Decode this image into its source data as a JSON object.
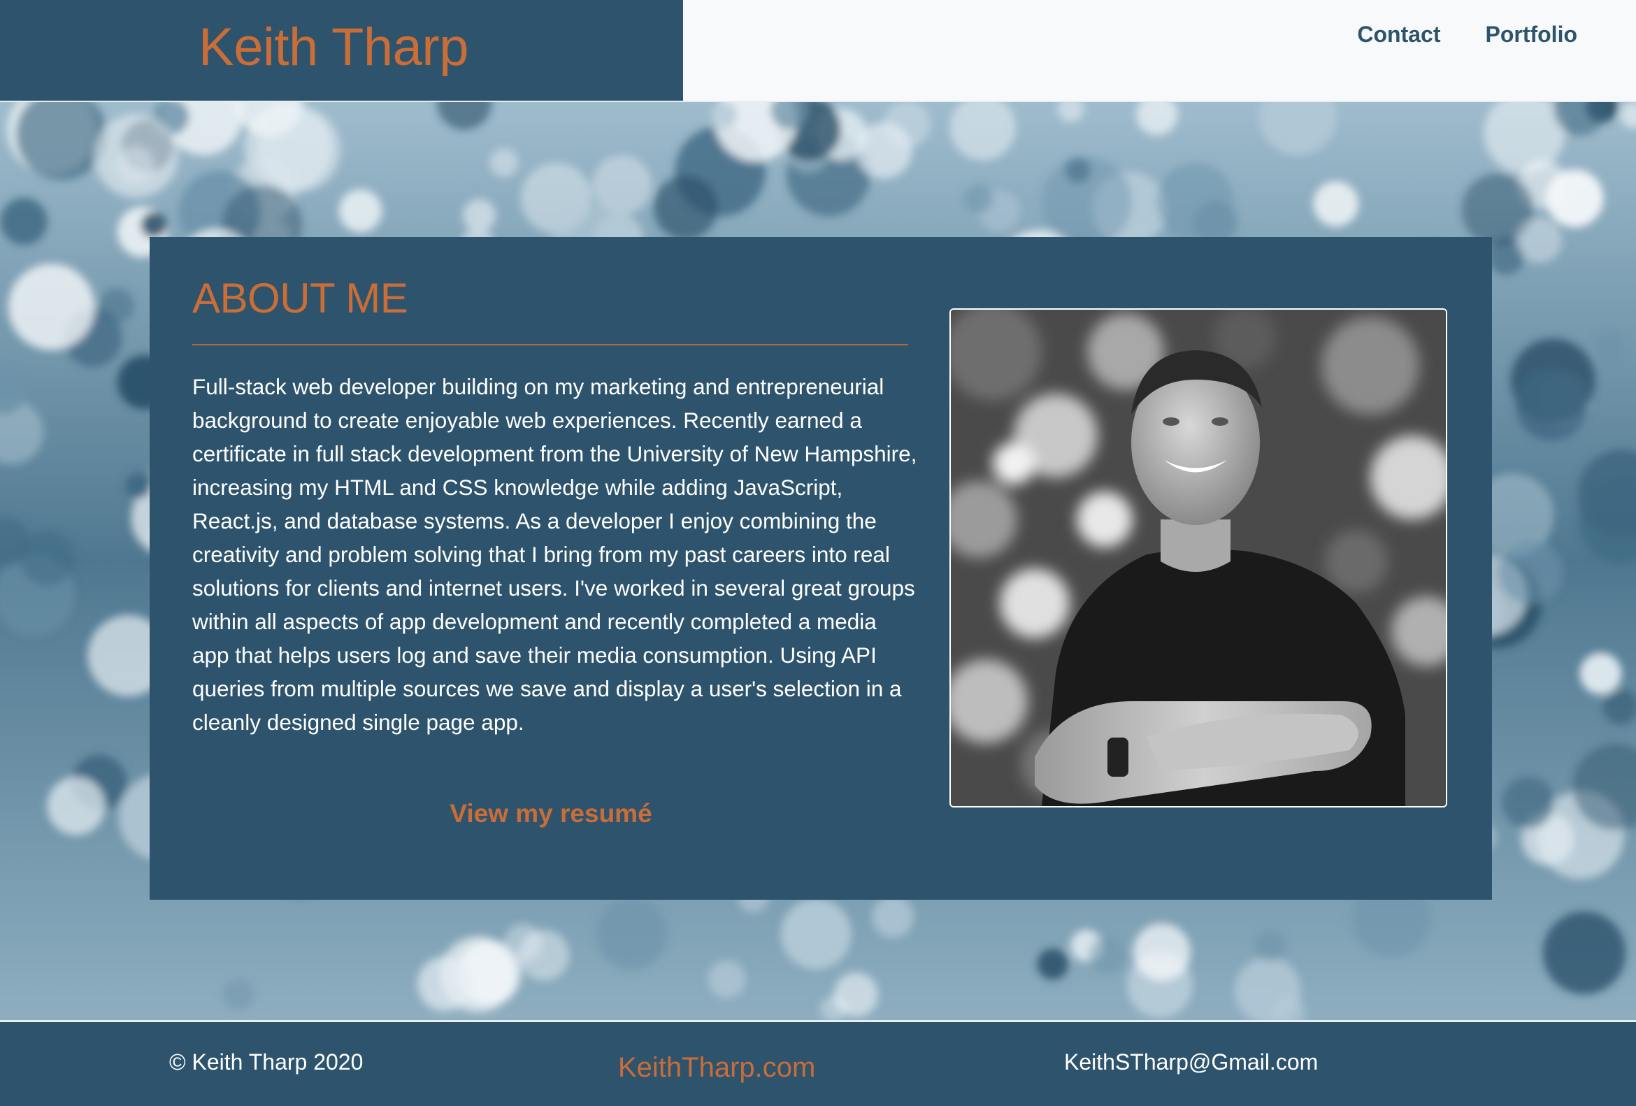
{
  "header": {
    "brand": "Keith Tharp",
    "nav": [
      {
        "label": "Contact"
      },
      {
        "label": "Portfolio"
      }
    ]
  },
  "about": {
    "title": "ABOUT ME",
    "text": "Full-stack web developer building on my marketing and entrepreneurial background to create enjoyable web experiences. Recently earned a certificate in full stack development from the University of New Hampshire, increasing my HTML and CSS knowledge while adding JavaScript, React.js, and database systems. As a developer I enjoy combining the creativity and problem solving that I bring from my past careers into real solutions for clients and internet users. I've worked in several great groups within all aspects of app development and recently completed a media app that helps users log and save their media consumption. Using API queries from multiple sources we save and display a user's selection in a cleanly designed single page app.",
    "resume_link": "View my resumé"
  },
  "footer": {
    "copyright": "© Keith Tharp 2020",
    "site": "KeithTharp.com",
    "email": "KeithSTharp@Gmail.com"
  },
  "colors": {
    "primary": "#2d546c",
    "accent": "#cb6d37",
    "light": "#f8f9fa",
    "text": "#ffffff"
  }
}
